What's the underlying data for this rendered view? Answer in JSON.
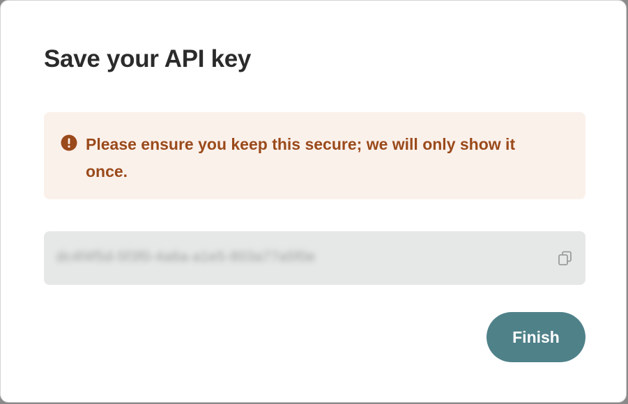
{
  "dialog": {
    "title": "Save your API key",
    "warning": {
      "icon": "exclamation-circle-icon",
      "message": "Please ensure you keep this secure; we will only show it once."
    },
    "api_key": {
      "value": "dc4f4f5d-5f3f0-4a6a-a1e5-803a77a5f0e",
      "copy_icon": "copy-icon"
    },
    "finish_label": "Finish"
  },
  "colors": {
    "warning_bg": "#fbf1eb",
    "warning_text": "#9a4a1b",
    "field_bg": "#e6e7e7",
    "primary_button": "#4f8189"
  }
}
